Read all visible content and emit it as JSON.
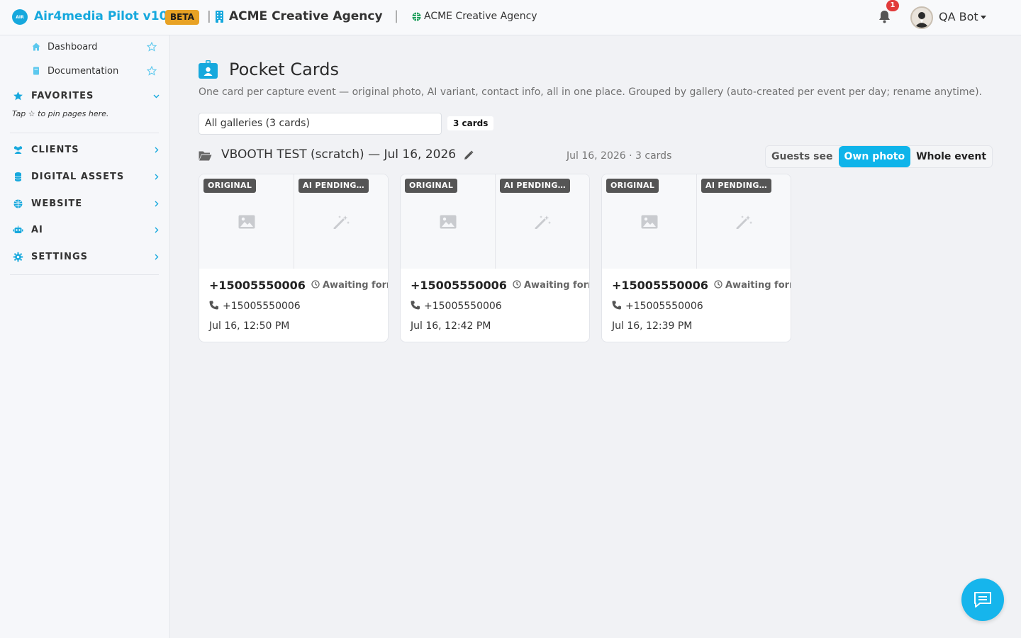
{
  "topbar": {
    "brand_name": "Air4media Pilot v10",
    "brand_logo_text": "AIR",
    "beta_label": "BETA",
    "separator": "|",
    "agency_name": "ACME Creative Agency",
    "agency_site": "ACME Creative Agency",
    "notification_count": "1",
    "user_name": "QA Bot"
  },
  "sidebar": {
    "links": [
      {
        "label": "Dashboard",
        "icon": "home-icon"
      },
      {
        "label": "Documentation",
        "icon": "book-icon"
      }
    ],
    "favorites_label": "FAVORITES",
    "favorites_hint": "Tap ☆ to pin pages here.",
    "sections": [
      {
        "label": "CLIENTS",
        "icon": "users-icon"
      },
      {
        "label": "DIGITAL ASSETS",
        "icon": "database-icon"
      },
      {
        "label": "WEBSITE",
        "icon": "globe-icon"
      },
      {
        "label": "AI",
        "icon": "robot-icon"
      },
      {
        "label": "SETTINGS",
        "icon": "gear-icon"
      }
    ]
  },
  "main": {
    "title": "Pocket Cards",
    "subtitle": "One card per capture event — original photo, AI variant, contact info, all in one place. Grouped by gallery (auto-created per event per day; rename anytime).",
    "gallery_select_value": "All galleries (3 cards)",
    "count_badge": "3 cards",
    "group": {
      "title": "VBOOTH TEST (scratch) — Jul 16, 2026",
      "meta": "Jul 16, 2026 · 3 cards"
    },
    "view_toggle": [
      "Guests see",
      "Own photo",
      "Whole event"
    ],
    "active_view": "Own photo",
    "cards": [
      {
        "original_tag": "ORIGINAL",
        "ai_tag": "AI PENDING…",
        "phone": "+15005550006",
        "status": "Awaiting form",
        "contact": "+15005550006",
        "time": "Jul 16, 12:50 PM"
      },
      {
        "original_tag": "ORIGINAL",
        "ai_tag": "AI PENDING…",
        "phone": "+15005550006",
        "status": "Awaiting form",
        "contact": "+15005550006",
        "time": "Jul 16, 12:42 PM"
      },
      {
        "original_tag": "ORIGINAL",
        "ai_tag": "AI PENDING…",
        "phone": "+15005550006",
        "status": "Awaiting form",
        "contact": "+15005550006",
        "time": "Jul 16, 12:39 PM"
      }
    ]
  },
  "colors": {
    "accent": "#16a8dd",
    "beta": "#e8a224",
    "badge_red": "#e13b3b",
    "active_toggle": "#0fb4ea"
  }
}
